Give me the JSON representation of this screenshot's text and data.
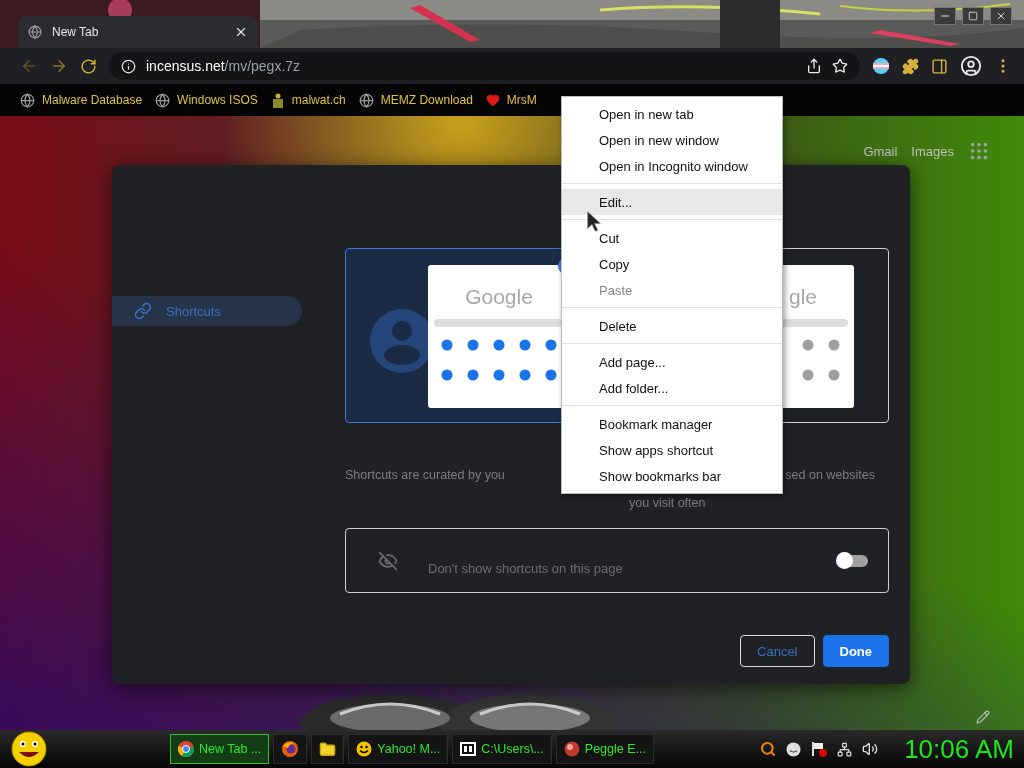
{
  "window": {
    "tab_title": "New Tab"
  },
  "toolbar": {
    "url_host": "incensus.net",
    "url_path": "/mv/pegx.7z"
  },
  "bookmarks": [
    {
      "label": "Malware Database",
      "kind": "globe"
    },
    {
      "label": "Windows ISOS",
      "kind": "globe"
    },
    {
      "label": "malwat.ch",
      "kind": "figure"
    },
    {
      "label": "MEMZ Download",
      "kind": "globe"
    },
    {
      "label": "MrsM",
      "kind": "heart"
    }
  ],
  "ntp_header": {
    "links": [
      "Gmail",
      "Images"
    ]
  },
  "dialog": {
    "sidebar": [
      {
        "label": "Shortcuts",
        "selected": true
      }
    ],
    "options": [
      {
        "kind": "my_shortcuts",
        "selected": true,
        "preview_title": "Google",
        "caption_lines": [
          "Shortcuts are curated by you"
        ]
      },
      {
        "kind": "most_visited",
        "selected": false,
        "preview_title": "gle",
        "caption_lines": [
          "sed on websites",
          "you visit often"
        ]
      }
    ],
    "hide_row": {
      "label": "Don't show shortcuts on this page",
      "on": false
    },
    "buttons": [
      {
        "label": "Cancel",
        "kind": "outline"
      },
      {
        "label": "Done",
        "kind": "primary"
      }
    ]
  },
  "context_menu": {
    "groups": [
      [
        {
          "label": "Open in new tab",
          "disabled": false,
          "selected": false
        },
        {
          "label": "Open in new window",
          "disabled": false,
          "selected": false
        },
        {
          "label": "Open in Incognito window",
          "disabled": false,
          "selected": false
        }
      ],
      [
        {
          "label": "Edit...",
          "disabled": false,
          "selected": true
        }
      ],
      [
        {
          "label": "Cut",
          "disabled": false,
          "selected": false
        },
        {
          "label": "Copy",
          "disabled": false,
          "selected": false
        },
        {
          "label": "Paste",
          "disabled": true,
          "selected": false
        }
      ],
      [
        {
          "label": "Delete",
          "disabled": false,
          "selected": false
        }
      ],
      [
        {
          "label": "Add page...",
          "disabled": false,
          "selected": false
        },
        {
          "label": "Add folder...",
          "disabled": false,
          "selected": false
        }
      ],
      [
        {
          "label": "Bookmark manager",
          "disabled": false,
          "selected": false
        },
        {
          "label": "Show apps shortcut",
          "disabled": false,
          "selected": false
        },
        {
          "label": "Show bookmarks bar",
          "disabled": false,
          "selected": false
        }
      ]
    ]
  },
  "taskbar": {
    "tasks": [
      {
        "label": "New Tab ...",
        "kind": "chrome",
        "selected": true
      },
      {
        "kind": "firefox",
        "selected": false
      },
      {
        "kind": "folder",
        "selected": false
      },
      {
        "label": "Yahoo! M...",
        "kind": "smiley",
        "selected": false
      },
      {
        "label": "C:\\Users\\...",
        "kind": "archive",
        "selected": false
      },
      {
        "label": "Peggle E...",
        "kind": "peggle",
        "selected": false
      }
    ],
    "clock": "10:06 AM"
  }
}
